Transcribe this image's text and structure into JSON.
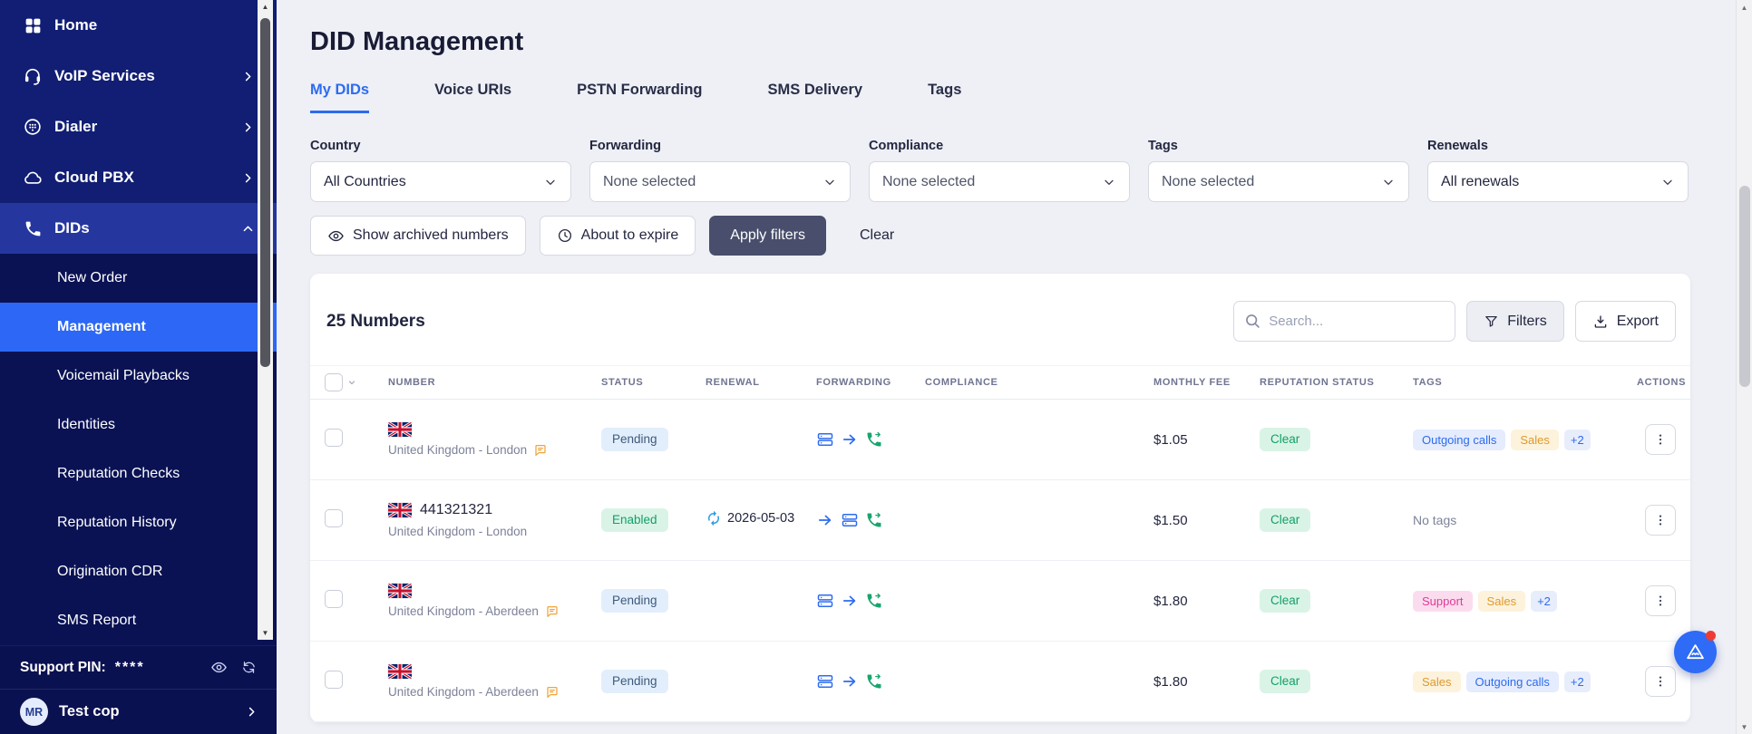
{
  "colors": {
    "accent_blue": "#2d6bf0",
    "sidebar_bg": "#111e74",
    "submenu_bg": "#0a1254",
    "selected_item": "#2c68f5",
    "apply_button": "#484e6b",
    "success_green": "#12a066",
    "pending_blue": "#e2eefb",
    "tag_orange": "#dd9a30",
    "tag_pink": "#e03a98",
    "notification_red": "#ee3b34"
  },
  "sidebar": {
    "items": [
      {
        "label": "Home",
        "icon": "grid"
      },
      {
        "label": "VoIP Services",
        "icon": "headset",
        "chevron": "right"
      },
      {
        "label": "Dialer",
        "icon": "dialer",
        "chevron": "right"
      },
      {
        "label": "Cloud PBX",
        "icon": "cloud",
        "chevron": "right"
      },
      {
        "label": "DIDs",
        "icon": "phone",
        "chevron": "up",
        "active_parent": true
      },
      {
        "label": "New Order",
        "sub": true
      },
      {
        "label": "Management",
        "sub": true,
        "selected": true
      },
      {
        "label": "Voicemail Playbacks",
        "sub": true
      },
      {
        "label": "Identities",
        "sub": true
      },
      {
        "label": "Reputation Checks",
        "sub": true
      },
      {
        "label": "Reputation History",
        "sub": true
      },
      {
        "label": "Origination CDR",
        "sub": true
      },
      {
        "label": "SMS Report",
        "sub": true
      }
    ],
    "support_pin_label": "Support PIN:",
    "support_pin_value": "****",
    "user": {
      "initials": "MR",
      "name": "Test cop"
    }
  },
  "header": {
    "title": "DID Management"
  },
  "tabs": [
    {
      "label": "My DIDs",
      "active": true
    },
    {
      "label": "Voice URIs"
    },
    {
      "label": "PSTN Forwarding"
    },
    {
      "label": "SMS Delivery"
    },
    {
      "label": "Tags"
    }
  ],
  "filters": {
    "fields": [
      {
        "label": "Country",
        "value": "All Countries",
        "muted": false
      },
      {
        "label": "Forwarding",
        "value": "None selected",
        "muted": true
      },
      {
        "label": "Compliance",
        "value": "None selected",
        "muted": true
      },
      {
        "label": "Tags",
        "value": "None selected",
        "muted": true
      },
      {
        "label": "Renewals",
        "value": "All renewals",
        "muted": false
      }
    ],
    "show_archived_label": "Show archived numbers",
    "about_to_expire_label": "About to expire",
    "apply_label": "Apply filters",
    "clear_label": "Clear"
  },
  "toolbar": {
    "count_label": "25 Numbers",
    "search_placeholder": "Search...",
    "filters_label": "Filters",
    "export_label": "Export"
  },
  "table": {
    "columns": [
      "NUMBER",
      "STATUS",
      "RENEWAL",
      "FORWARDING",
      "COMPLIANCE",
      "MONTHLY FEE",
      "REPUTATION STATUS",
      "TAGS",
      "ACTIONS"
    ],
    "rows": [
      {
        "number": "",
        "location": "United Kingdom - London",
        "note_icon": true,
        "status": {
          "label": "Pending",
          "variant": "pending"
        },
        "renewal": "",
        "forwarding": [
          "trunk",
          "arrow",
          "phonefwd"
        ],
        "fee": "$1.05",
        "reputation": "Clear",
        "tags": [
          {
            "label": "Outgoing calls",
            "variant": "blue"
          },
          {
            "label": "Sales",
            "variant": "orange"
          },
          {
            "label": "+2",
            "variant": "more"
          }
        ]
      },
      {
        "number": "441321321",
        "location": "United Kingdom - London",
        "note_icon": false,
        "status": {
          "label": "Enabled",
          "variant": "enabled"
        },
        "renewal": "2026-05-03",
        "forwarding": [
          "arrow",
          "trunk",
          "phonefwd"
        ],
        "fee": "$1.50",
        "reputation": "Clear",
        "tags": [],
        "no_tags": "No tags"
      },
      {
        "number": "",
        "location": "United Kingdom - Aberdeen",
        "note_icon": true,
        "status": {
          "label": "Pending",
          "variant": "pending"
        },
        "renewal": "",
        "forwarding": [
          "trunk",
          "arrow",
          "phonefwd"
        ],
        "fee": "$1.80",
        "reputation": "Clear",
        "tags": [
          {
            "label": "Support",
            "variant": "pink"
          },
          {
            "label": "Sales",
            "variant": "orange"
          },
          {
            "label": "+2",
            "variant": "more"
          }
        ]
      },
      {
        "number": "",
        "location": "United Kingdom - Aberdeen",
        "note_icon": true,
        "status": {
          "label": "Pending",
          "variant": "pending"
        },
        "renewal": "",
        "forwarding": [
          "trunk",
          "arrow",
          "phonefwd"
        ],
        "fee": "$1.80",
        "reputation": "Clear",
        "tags": [
          {
            "label": "Sales",
            "variant": "orange"
          },
          {
            "label": "Outgoing calls",
            "variant": "blue"
          },
          {
            "label": "+2",
            "variant": "more"
          }
        ]
      }
    ]
  }
}
